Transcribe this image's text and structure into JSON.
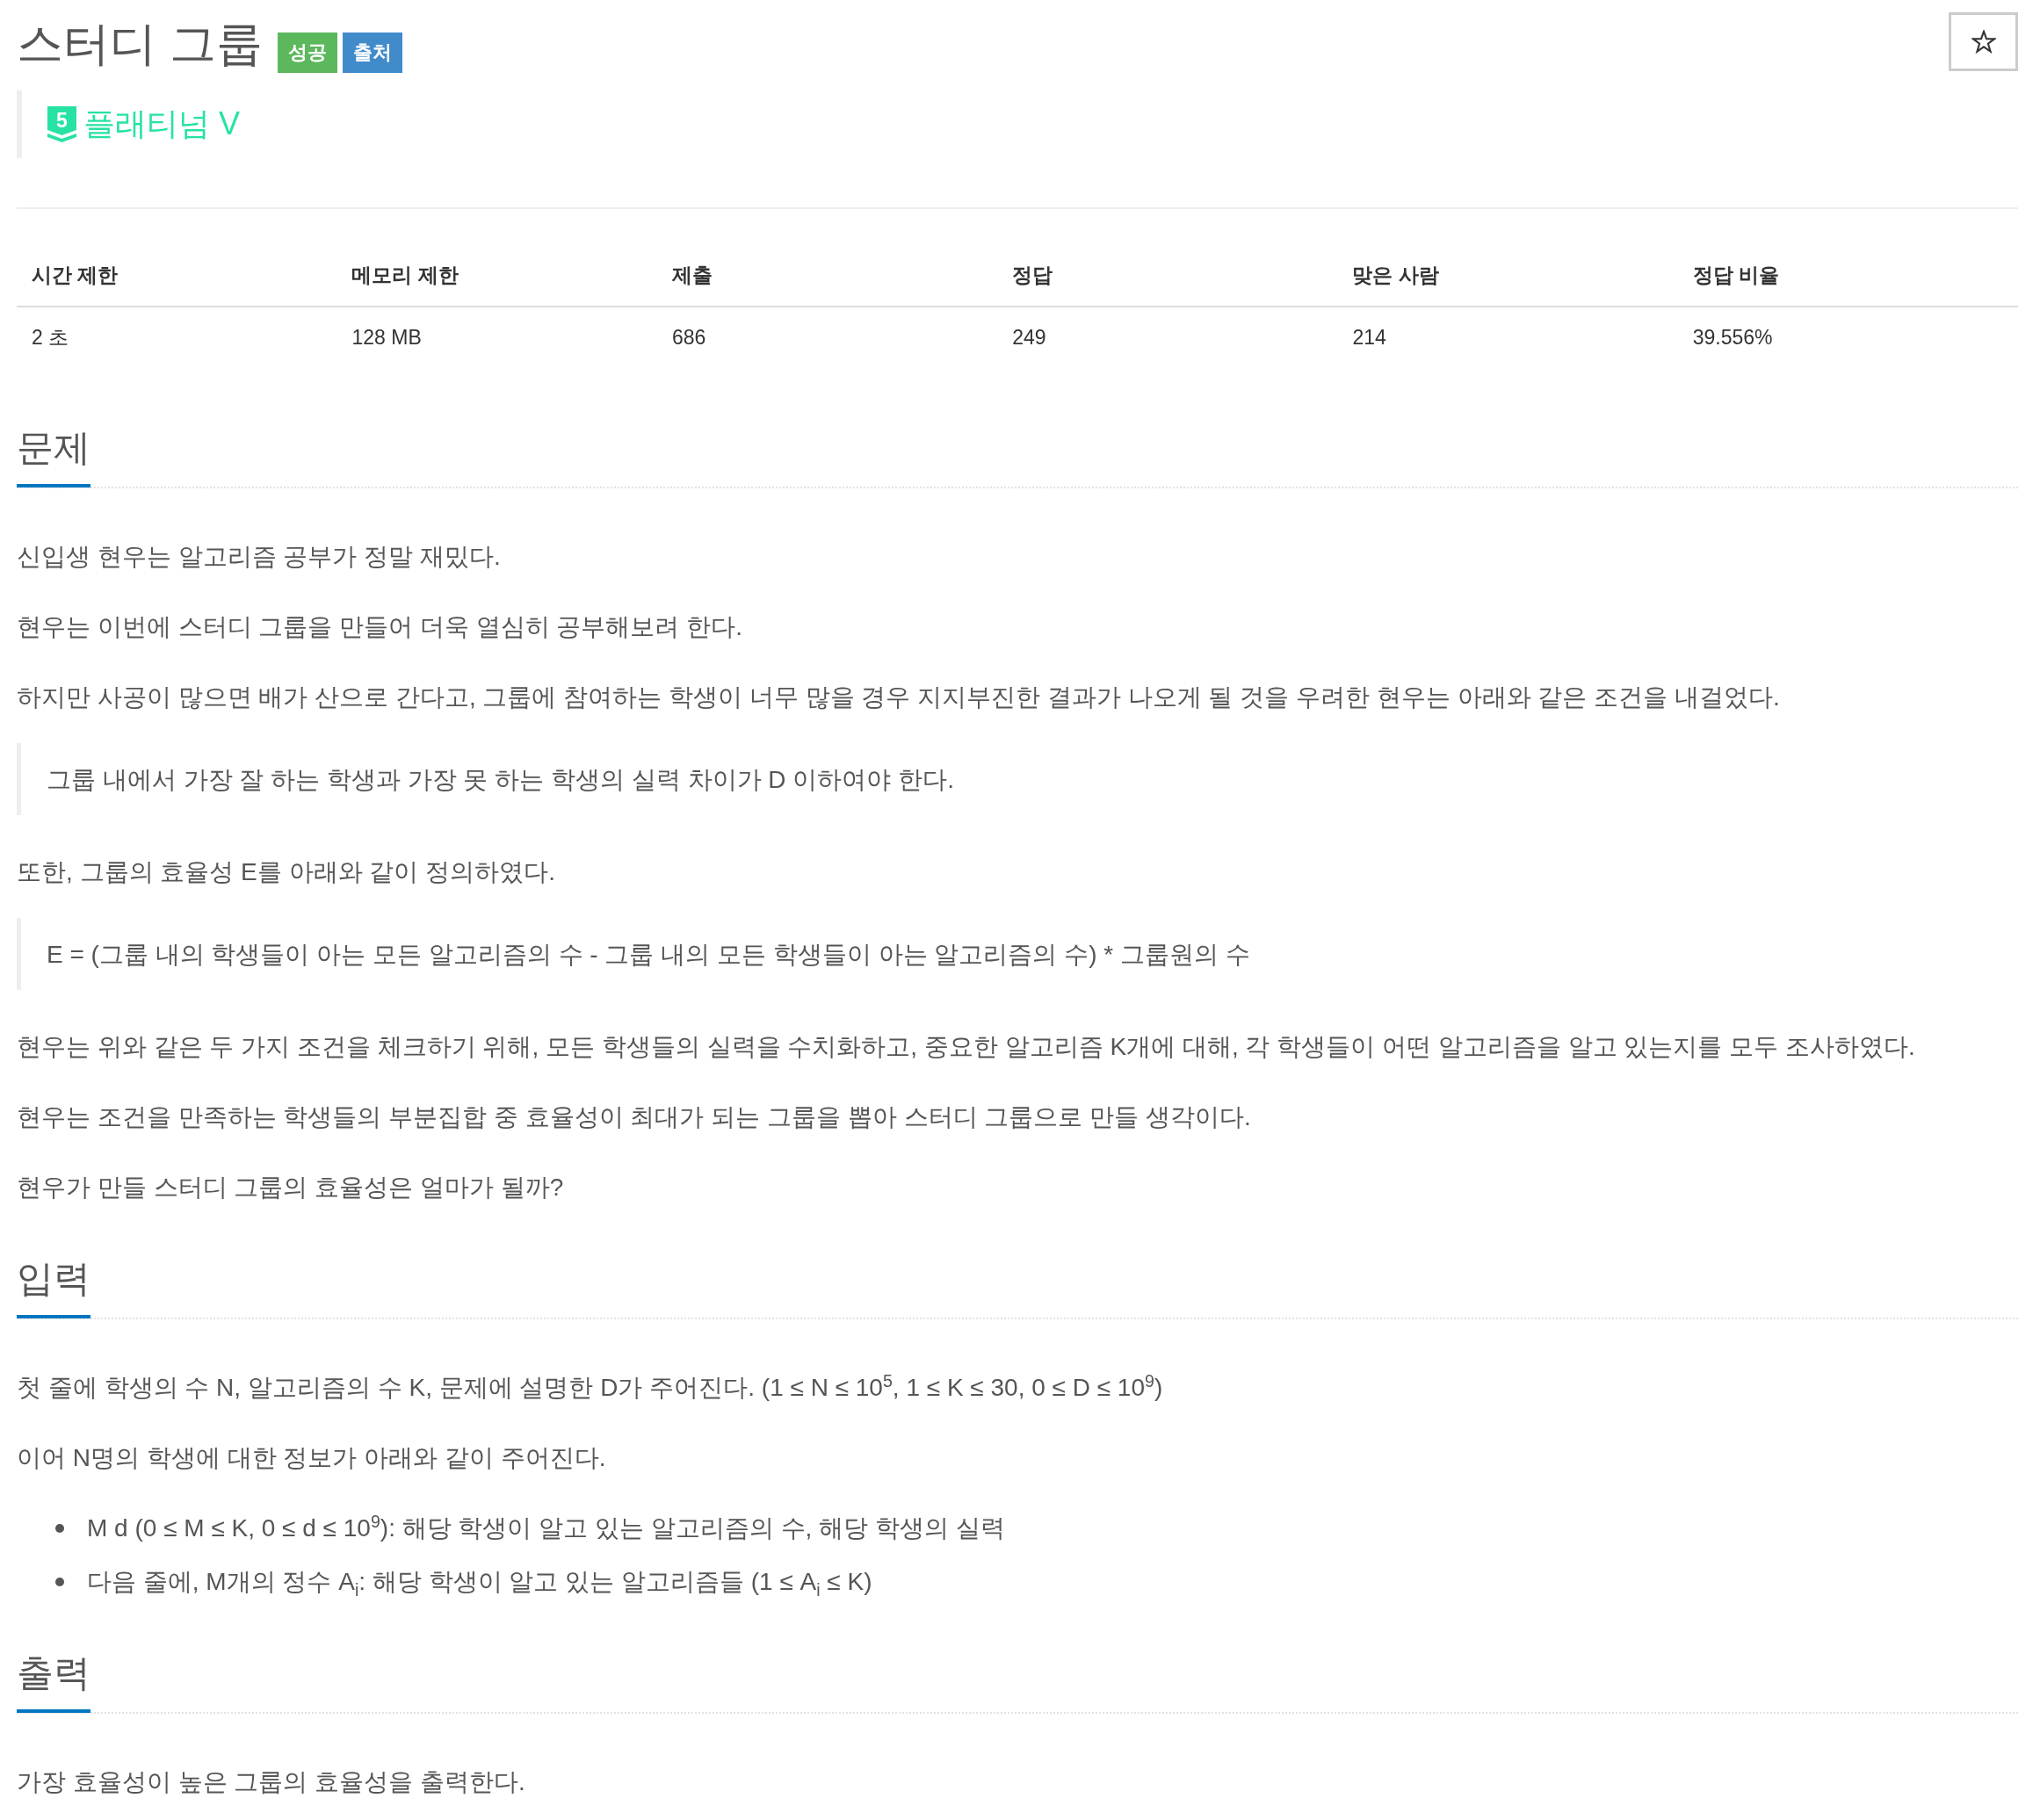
{
  "title": "스터디 그룹",
  "labels": [
    {
      "text": "성공",
      "color": "#5cb85c"
    },
    {
      "text": "출처",
      "color": "#428bca"
    }
  ],
  "star_button": {
    "starred": false
  },
  "tier": {
    "badge": "5",
    "name": "플래티넘 V"
  },
  "info_table": {
    "columns": [
      "시간 제한",
      "메모리 제한",
      "제출",
      "정답",
      "맞은 사람",
      "정답 비율"
    ],
    "rows": [
      [
        "2 초",
        "128 MB",
        "686",
        "249",
        "214",
        "39.556%"
      ]
    ]
  },
  "sections": [
    {
      "heading": "문제",
      "blocks": [
        {
          "kind": "paragraph",
          "text": "신입생 현우는 알고리즘 공부가 정말 재밌다."
        },
        {
          "kind": "paragraph",
          "text": "현우는 이번에 스터디 그룹을 만들어 더욱 열심히 공부해보려 한다."
        },
        {
          "kind": "paragraph",
          "text": "하지만 사공이 많으면 배가 산으로 간다고, 그룹에 참여하는 학생이 너무 많을 경우 지지부진한 결과가 나오게 될 것을 우려한 현우는 아래와 같은 조건을 내걸었다."
        },
        {
          "kind": "quote",
          "text": "그룹 내에서 가장 잘 하는 학생과 가장 못 하는 학생의 실력 차이가 D 이하여야 한다."
        },
        {
          "kind": "paragraph",
          "text": "또한, 그룹의 효율성 E를 아래와 같이 정의하였다."
        },
        {
          "kind": "quote",
          "text": "E = (그룹 내의 학생들이 아는 모든 알고리즘의 수 - 그룹 내의 모든 학생들이 아는 알고리즘의 수) * 그룹원의 수"
        },
        {
          "kind": "paragraph",
          "text": "현우는 위와 같은 두 가지 조건을 체크하기 위해, 모든 학생들의 실력을 수치화하고, 중요한 알고리즘 K개에 대해, 각 학생들이 어떤 알고리즘을 알고 있는지를 모두 조사하였다."
        },
        {
          "kind": "paragraph",
          "text": "현우는 조건을 만족하는 학생들의 부분집합 중 효율성이 최대가 되는 그룹을 뽑아 스터디 그룹으로 만들 생각이다."
        },
        {
          "kind": "paragraph",
          "text": "현우가 만들 스터디 그룹의 효율성은 얼마가 될까?"
        }
      ]
    },
    {
      "heading": "입력",
      "blocks": [
        {
          "kind": "paragraph",
          "text": "첫 줄에 학생의 수 N, 알고리즘의 수 K, 문제에 설명한 D가 주어진다. (1 ≤ N ≤ 10$^{5}$, 1 ≤ K ≤ 30, 0 ≤ D ≤ 10$^{9}$)"
        },
        {
          "kind": "paragraph",
          "text": "이어 N명의 학생에 대한 정보가 아래와 같이 주어진다."
        },
        {
          "kind": "list",
          "items": [
            "M d (0 ≤ M ≤ K, 0 ≤ d ≤ 10$^{9}$): 해당 학생이 알고 있는 알고리즘의 수, 해당 학생의 실력",
            "다음 줄에, M개의 정수 A$_{i}$: 해당 학생이 알고 있는 알고리즘들 (1 ≤ A$_{i}$ ≤ K)"
          ]
        }
      ]
    },
    {
      "heading": "출력",
      "blocks": [
        {
          "kind": "paragraph",
          "text": "가장 효율성이 높은 그룹의 효율성을 출력한다."
        }
      ]
    }
  ]
}
